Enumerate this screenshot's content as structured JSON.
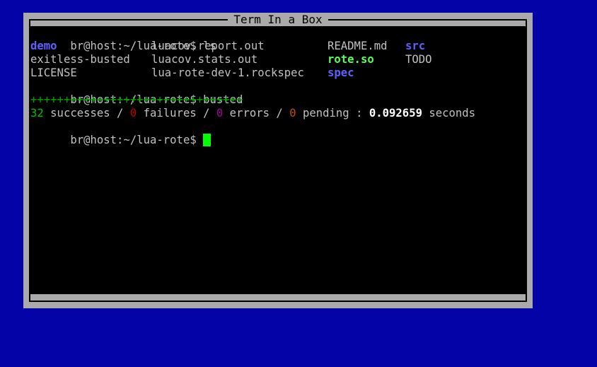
{
  "window": {
    "title": "Term In a Box"
  },
  "colors": {
    "desktop": "#0303a8",
    "frame": "#aaaaaa",
    "terminal_bg": "#000000",
    "text": "#c0c0c0",
    "directory": "#5f5fff",
    "executable": "#55ff55",
    "cursor": "#00ff00"
  },
  "terminal": {
    "prompt": "br@host:~/lua-rote$ ",
    "cmd1": "ls",
    "ls_rows": [
      [
        "demo",
        "luacov.report.out",
        "README.md",
        "src"
      ],
      [
        "exitless-busted",
        "luacov.stats.out",
        "rote.so",
        "TODO"
      ],
      [
        "LICENSE",
        "lua-rote-dev-1.rockspec",
        "spec",
        ""
      ]
    ],
    "cmd2": "busted",
    "progress": "++++++++++++++++++++++++++++++++",
    "summary": {
      "successes": "32",
      "successes_label": " successes / ",
      "failures": "0",
      "failures_label": " failures / ",
      "errors": "0",
      "errors_label": " errors / ",
      "pending": "0",
      "pending_label": " pending : ",
      "time": "0.092659",
      "seconds_label": " seconds"
    }
  }
}
